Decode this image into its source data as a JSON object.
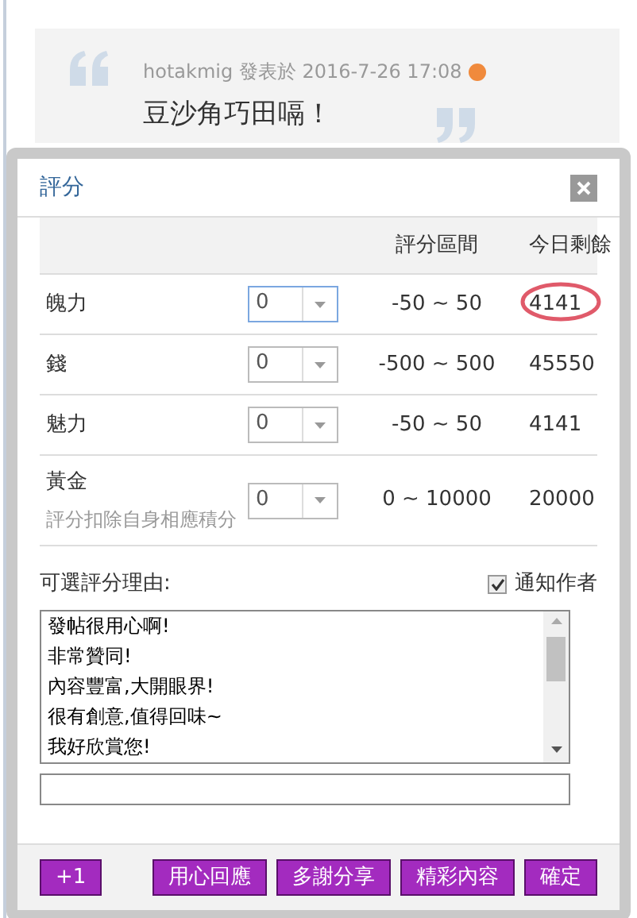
{
  "post": {
    "author": "hotakmig",
    "posted_label": "發表於",
    "datetime": "2016-7-26 17:08",
    "content": "豆沙角巧田嗝！"
  },
  "dialog": {
    "title": "評分",
    "columns": [
      "評分區間",
      "今日剩餘"
    ],
    "ratings": [
      {
        "name": "魄力",
        "value": "0",
        "range": "-50 ~ 50",
        "remaining": "4141",
        "focused": true,
        "circled": true
      },
      {
        "name": "錢",
        "value": "0",
        "range": "-500 ~ 500",
        "remaining": "45550",
        "focused": false,
        "circled": false
      },
      {
        "name": "魅力",
        "value": "0",
        "range": "-50 ~ 50",
        "remaining": "4141",
        "focused": false,
        "circled": false
      },
      {
        "name": "黃金",
        "note": "評分扣除自身相應積分",
        "value": "0",
        "range": "0 ~ 10000",
        "remaining": "20000",
        "focused": false,
        "circled": false
      }
    ],
    "reason_label": "可選評分理由:",
    "notify": {
      "label": "通知作者",
      "checked": true
    },
    "reasons": [
      "發帖很用心啊!",
      "非常贊同!",
      "內容豐富,大開眼界!",
      "很有創意,值得回味~",
      "我好欣賞您!"
    ],
    "buttons": [
      "+1",
      "用心回應",
      "多謝分享",
      "精彩內容",
      "確定"
    ]
  }
}
